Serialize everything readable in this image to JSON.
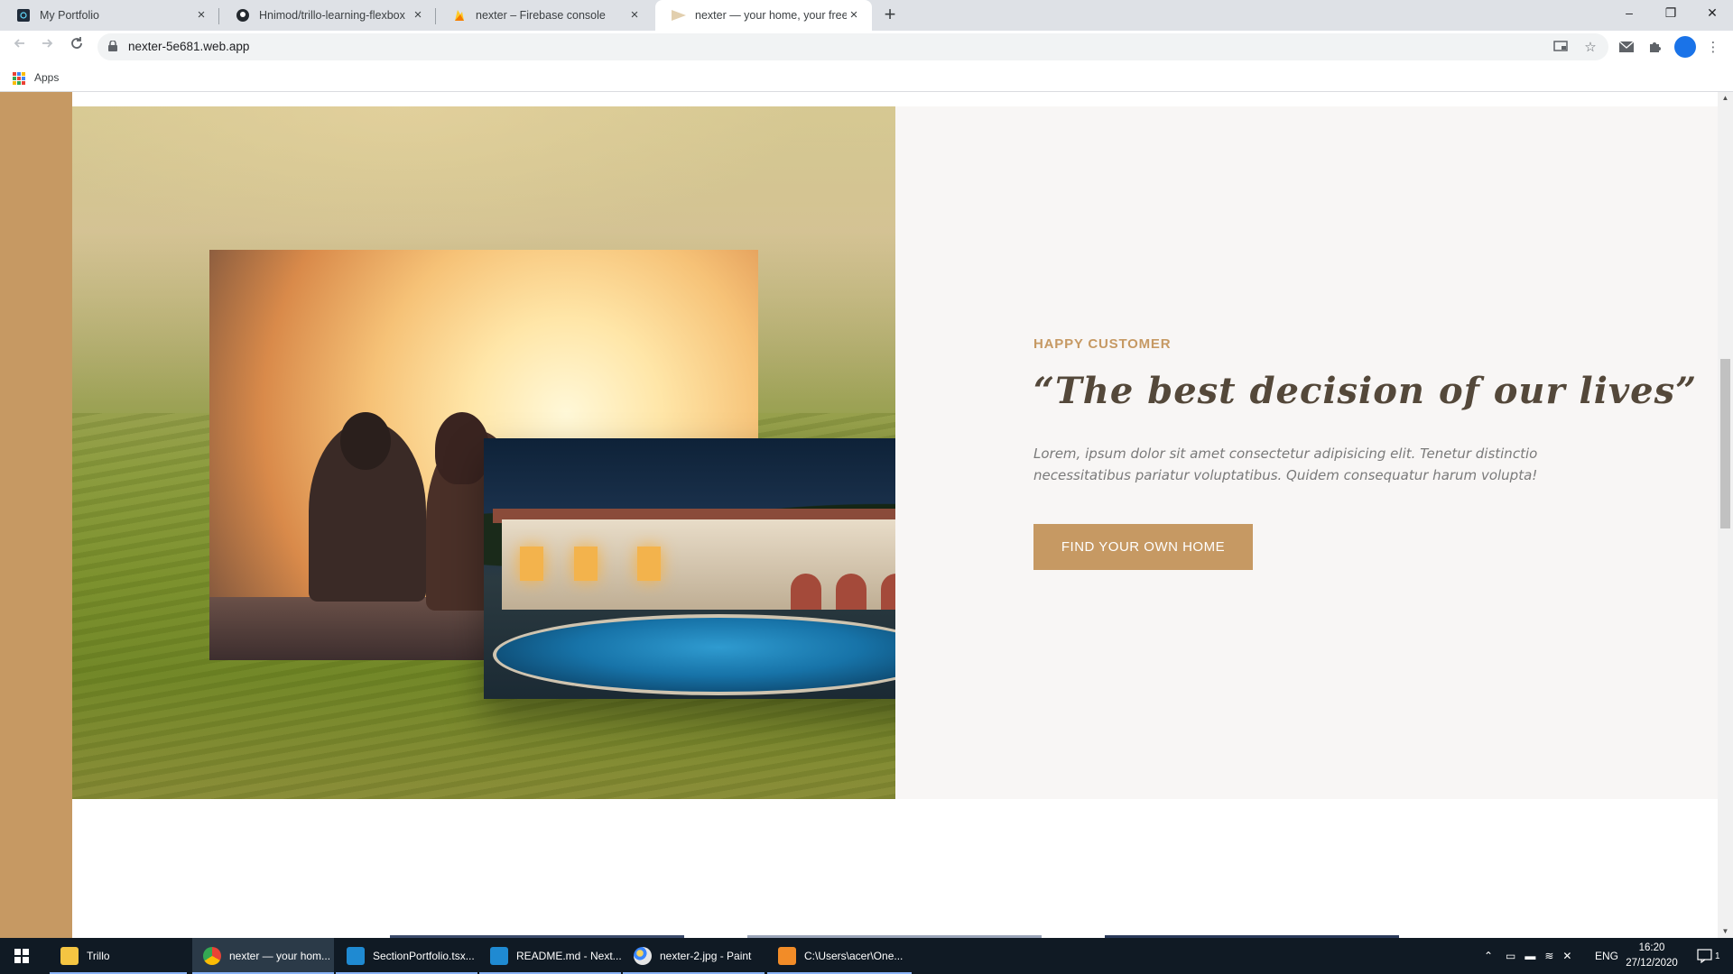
{
  "browser": {
    "tabs": [
      {
        "title": "My Portfolio",
        "icon": "portfolio-favicon"
      },
      {
        "title": "Hnimod/trillo-learning-flexbox",
        "icon": "github-icon"
      },
      {
        "title": "nexter – Firebase console",
        "icon": "firebase-icon"
      },
      {
        "title": "nexter — your home, your freedom",
        "icon": "nexter-favicon",
        "active": true
      }
    ],
    "new_tab_symbol": "+",
    "window_controls": {
      "minimize": "–",
      "restore": "❐",
      "close": "✕"
    },
    "url": "nexter-5e681.web.app",
    "bookmarks": {
      "apps_label": "Apps"
    }
  },
  "page": {
    "story": {
      "subheading": "Happy Customer",
      "heading": "“The best decision of our lives”",
      "text": "Lorem, ipsum dolor sit amet consectetur adipisicing elit. Tenetur distinctio necessitatibus pariatur voluptatibus. Quidem consequatur harum volupta!",
      "button_label": "Find your own home"
    },
    "colors": {
      "primary": "#c69963",
      "heading": "#54483a",
      "background_light": "#f8f6f5",
      "text": "#7a7a7a"
    }
  },
  "taskbar": {
    "items": [
      {
        "label": "Trillo",
        "icon": "folder-icon"
      },
      {
        "label": "nexter — your hom...",
        "icon": "chrome-icon",
        "active": true
      },
      {
        "label": "SectionPortfolio.tsx...",
        "icon": "vscode-icon"
      },
      {
        "label": "README.md - Next...",
        "icon": "vscode-icon"
      },
      {
        "label": "nexter-2.jpg - Paint",
        "icon": "paint-icon"
      },
      {
        "label": "C:\\Users\\acer\\One...",
        "icon": "sublime-icon"
      }
    ],
    "language": "ENG",
    "time": "16:20",
    "date": "27/12/2020",
    "notification_count": "1"
  }
}
